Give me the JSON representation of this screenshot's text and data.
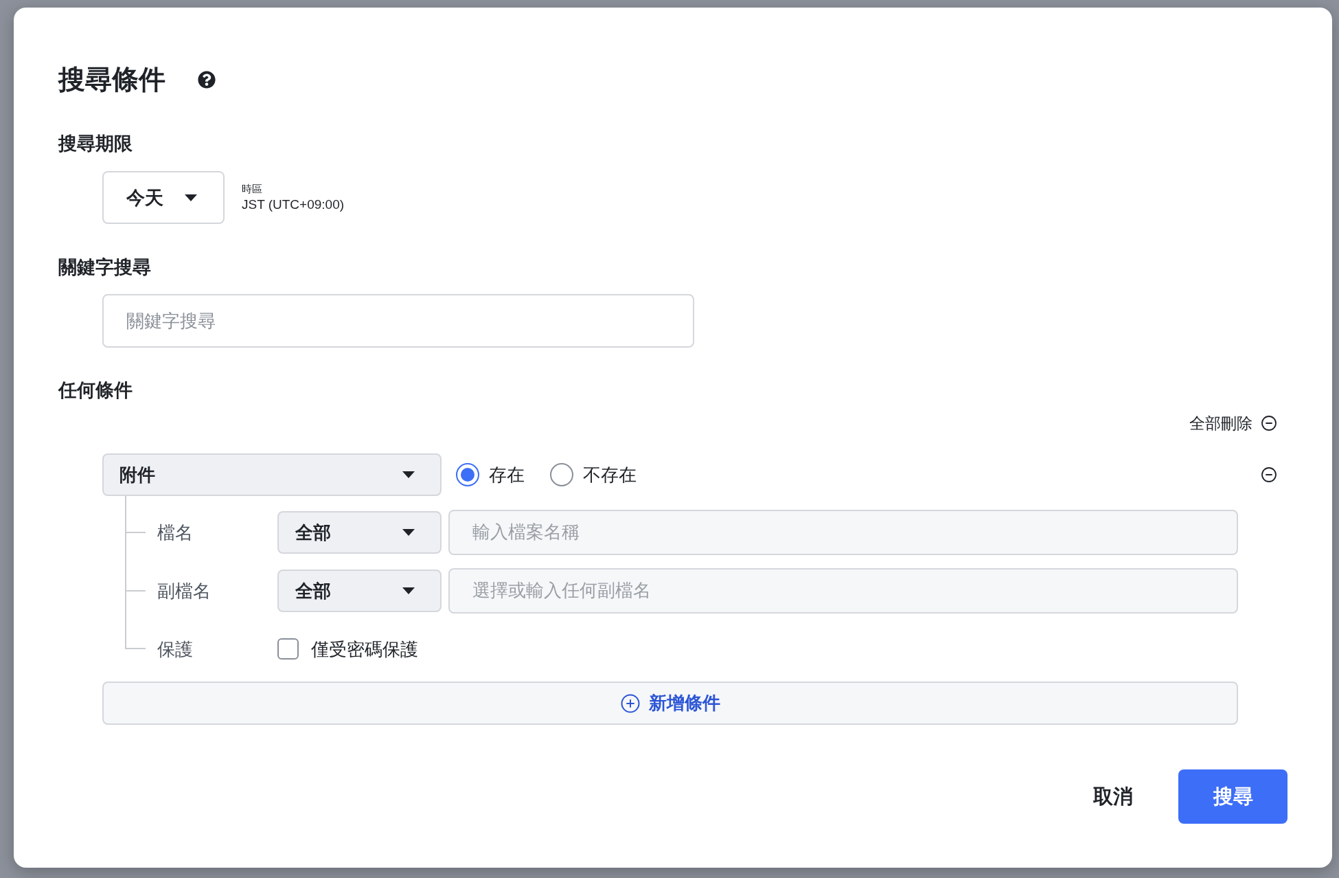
{
  "dialog": {
    "title": "搜尋條件"
  },
  "period": {
    "label": "搜尋期限",
    "dropdown": {
      "value": "今天"
    },
    "timezone": {
      "label": "時區",
      "value": "JST (UTC+09:00)"
    }
  },
  "keyword": {
    "label": "關鍵字搜尋",
    "placeholder": "關鍵字搜尋"
  },
  "conditions": {
    "label": "任何條件",
    "remove_all": "全部刪除",
    "items": [
      {
        "type": {
          "value": "附件"
        },
        "options": [
          {
            "label": "存在",
            "selected": true
          },
          {
            "label": "不存在",
            "selected": false
          }
        ],
        "fields": [
          {
            "kind": "select_text",
            "label": "檔名",
            "select": "全部",
            "placeholder": "輸入檔案名稱"
          },
          {
            "kind": "select_text",
            "label": "副檔名",
            "select": "全部",
            "placeholder": "選擇或輸入任何副檔名"
          },
          {
            "kind": "checkbox",
            "label": "保護",
            "option": "僅受密碼保護",
            "checked": false
          }
        ]
      }
    ],
    "add_button": "新增條件"
  },
  "buttons": [
    {
      "kind": "text",
      "label": "取消"
    },
    {
      "kind": "primary",
      "label": "搜尋"
    }
  ]
}
